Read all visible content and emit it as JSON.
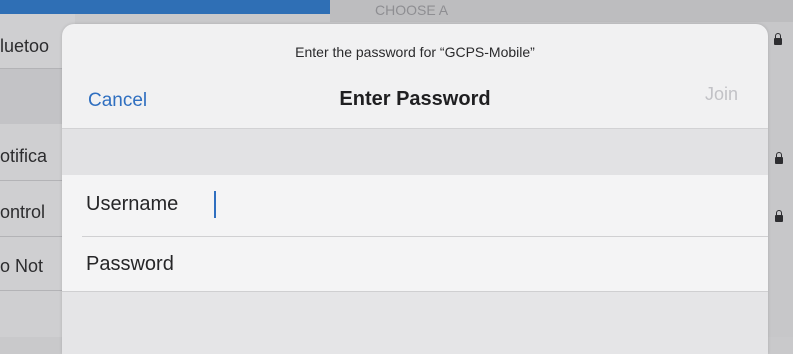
{
  "background": {
    "left_items": [
      "luetoo",
      "otifica",
      "ontrol",
      "o Not"
    ],
    "right_header": "CHOOSE A"
  },
  "dialog": {
    "prompt": "Enter the password for “GCPS-Mobile”",
    "cancel_label": "Cancel",
    "title": "Enter Password",
    "join_label": "Join",
    "username_label": "Username",
    "password_label": "Password"
  },
  "colors": {
    "accent": "#2f6fc0",
    "disabled": "#c2c2c6"
  }
}
